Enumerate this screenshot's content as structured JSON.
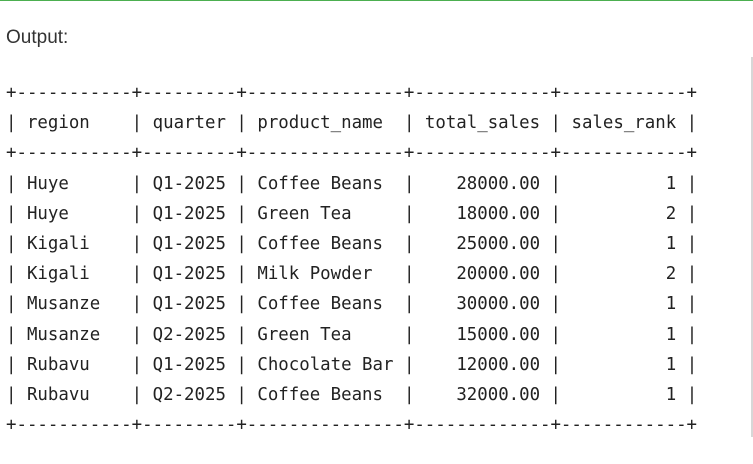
{
  "output_label": "Output:",
  "table": {
    "columns": [
      {
        "key": "region",
        "label": "region",
        "width": 9,
        "align": "left"
      },
      {
        "key": "quarter",
        "label": "quarter",
        "width": 7,
        "align": "left"
      },
      {
        "key": "product_name",
        "label": "product_name",
        "width": 13,
        "align": "left"
      },
      {
        "key": "total_sales",
        "label": "total_sales",
        "width": 11,
        "align": "right"
      },
      {
        "key": "sales_rank",
        "label": "sales_rank",
        "width": 10,
        "align": "right"
      }
    ],
    "rows": [
      [
        "Huye",
        "Q1-2025",
        "Coffee Beans",
        "28000.00",
        "1"
      ],
      [
        "Huye",
        "Q1-2025",
        "Green Tea",
        "18000.00",
        "2"
      ],
      [
        "Kigali",
        "Q1-2025",
        "Coffee Beans",
        "25000.00",
        "1"
      ],
      [
        "Kigali",
        "Q1-2025",
        "Milk Powder",
        "20000.00",
        "2"
      ],
      [
        "Musanze",
        "Q1-2025",
        "Coffee Beans",
        "30000.00",
        "1"
      ],
      [
        "Musanze",
        "Q2-2025",
        "Green Tea",
        "15000.00",
        "1"
      ],
      [
        "Rubavu",
        "Q1-2025",
        "Chocolate Bar",
        "12000.00",
        "1"
      ],
      [
        "Rubavu",
        "Q2-2025",
        "Coffee Beans",
        "32000.00",
        "1"
      ]
    ]
  }
}
